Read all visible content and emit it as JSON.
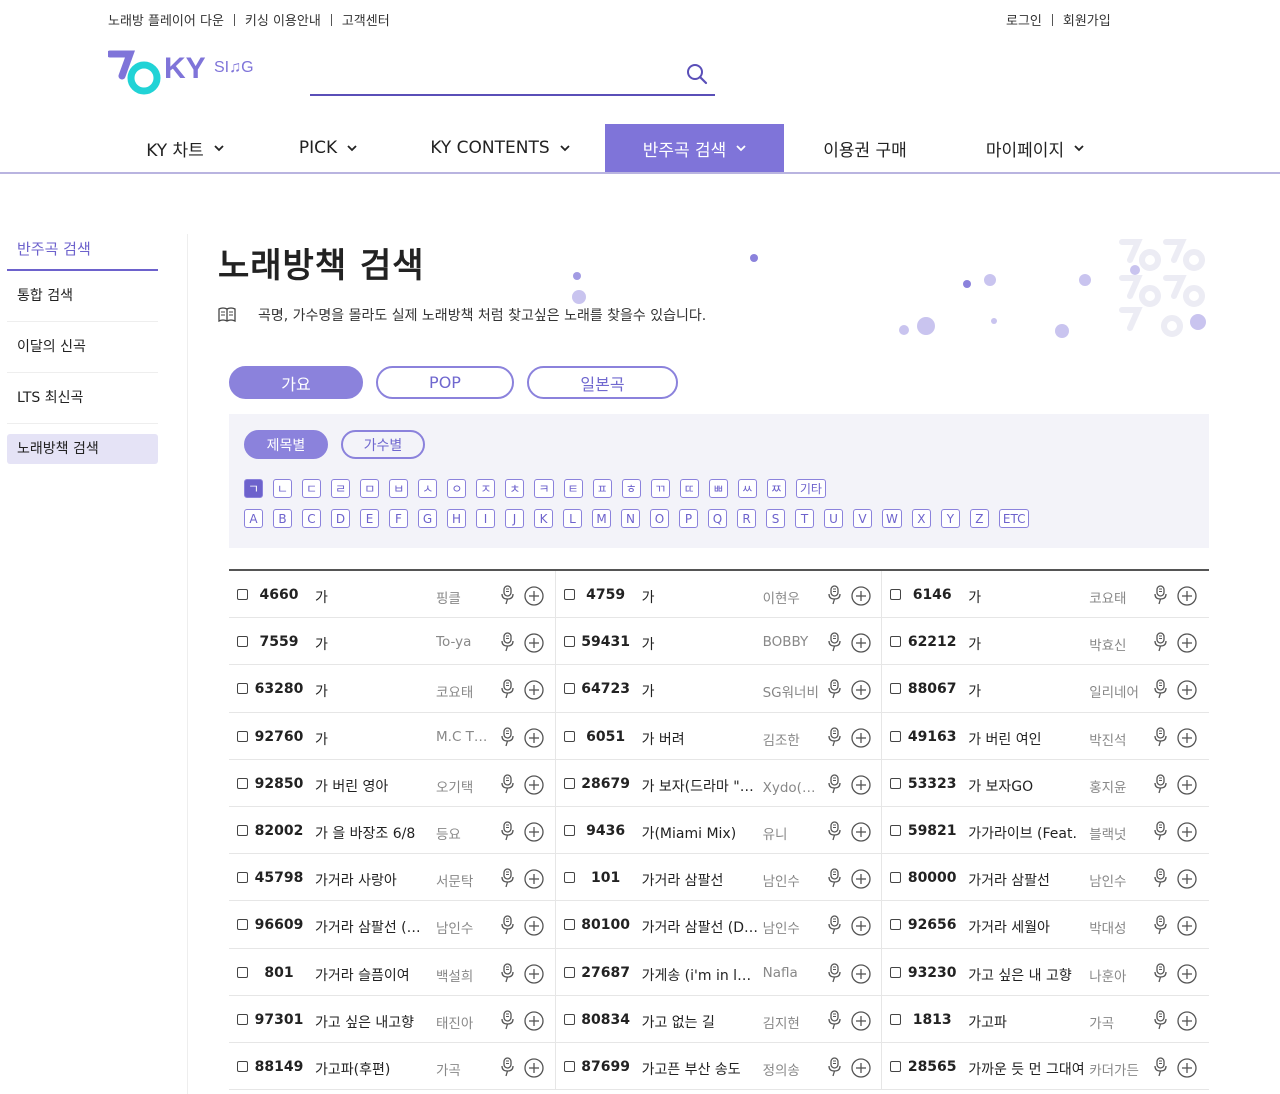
{
  "top_links": [
    "노래방 플레이어 다운",
    "키싱 이용안내",
    "고객센터"
  ],
  "auth_links": [
    "로그인",
    "회원가입"
  ],
  "search": {
    "placeholder": ""
  },
  "nav": [
    {
      "label": "KY 차트",
      "dropdown": true,
      "active": false
    },
    {
      "label": "PICK",
      "dropdown": true,
      "active": false
    },
    {
      "label": "KY CONTENTS",
      "dropdown": true,
      "active": false
    },
    {
      "label": "반주곡 검색",
      "dropdown": true,
      "active": true
    },
    {
      "label": "이용권 구매",
      "dropdown": false,
      "active": false
    },
    {
      "label": "마이페이지",
      "dropdown": true,
      "active": false
    }
  ],
  "sidebar": {
    "title": "반주곡 검색",
    "items": [
      "통합 검색",
      "이달의 신곡",
      "LTS 최신곡",
      "노래방책 검색"
    ],
    "active_index": 3
  },
  "page": {
    "title": "노래방책 검색",
    "description": "곡명, 가수명을 몰라도 실제 노래방책 처럼 찾고싶은 노래를 찾을수 있습니다."
  },
  "categories": [
    "가요",
    "POP",
    "일본곡"
  ],
  "category_active": 0,
  "sort_tabs": [
    "제목별",
    "가수별"
  ],
  "sort_active": 0,
  "korean_keys": [
    "ㄱ",
    "ㄴ",
    "ㄷ",
    "ㄹ",
    "ㅁ",
    "ㅂ",
    "ㅅ",
    "ㅇ",
    "ㅈ",
    "ㅊ",
    "ㅋ",
    "ㅌ",
    "ㅍ",
    "ㅎ",
    "ㄲ",
    "ㄸ",
    "ㅃ",
    "ㅆ",
    "ㅉ",
    "기타"
  ],
  "latin_keys": [
    "A",
    "B",
    "C",
    "D",
    "E",
    "F",
    "G",
    "H",
    "I",
    "J",
    "K",
    "L",
    "M",
    "N",
    "O",
    "P",
    "Q",
    "R",
    "S",
    "T",
    "U",
    "V",
    "W",
    "X",
    "Y",
    "Z",
    "ETC"
  ],
  "active_key": "ㄱ",
  "songs": [
    [
      {
        "num": "4660",
        "title": "가",
        "artist": "핑클"
      },
      {
        "num": "4759",
        "title": "가",
        "artist": "이현우"
      },
      {
        "num": "6146",
        "title": "가",
        "artist": "코요태"
      }
    ],
    [
      {
        "num": "7559",
        "title": "가",
        "artist": "To-ya"
      },
      {
        "num": "59431",
        "title": "가",
        "artist": "BOBBY"
      },
      {
        "num": "62212",
        "title": "가",
        "artist": "박효신"
      }
    ],
    [
      {
        "num": "63280",
        "title": "가",
        "artist": "코요태"
      },
      {
        "num": "64723",
        "title": "가",
        "artist": "SG워너비"
      },
      {
        "num": "88067",
        "title": "가",
        "artist": "일리네어"
      }
    ],
    [
      {
        "num": "92760",
        "title": "가",
        "artist": "M.C THE MAX"
      },
      {
        "num": "6051",
        "title": "가 버려",
        "artist": "김조한"
      },
      {
        "num": "49163",
        "title": "가 버린 여인",
        "artist": "박진석"
      }
    ],
    [
      {
        "num": "92850",
        "title": "가 버린 영아",
        "artist": "오기택"
      },
      {
        "num": "28679",
        "title": "가 보자(드라마 \"오늘부터 우리는\")",
        "artist": "Xydo(시도)"
      },
      {
        "num": "53323",
        "title": "가 보자GO",
        "artist": "홍지윤"
      }
    ],
    [
      {
        "num": "82002",
        "title": "가 을 바장조 6/8",
        "artist": "등요"
      },
      {
        "num": "9436",
        "title": "가(Miami Mix)",
        "artist": "유니"
      },
      {
        "num": "59821",
        "title": "가가라이브 (Feat.",
        "artist": "블랙넛"
      }
    ],
    [
      {
        "num": "45798",
        "title": "가거라 사랑아",
        "artist": "서문탁"
      },
      {
        "num": "101",
        "title": "가거라 삼팔선",
        "artist": "남인수"
      },
      {
        "num": "80000",
        "title": "가거라 삼팔선",
        "artist": "남인수"
      }
    ],
    [
      {
        "num": "96609",
        "title": "가거라 삼팔선 (디스코)",
        "artist": "남인수"
      },
      {
        "num": "80100",
        "title": "가거라 삼팔선 (Disco)",
        "artist": "남인수"
      },
      {
        "num": "92656",
        "title": "가거라 세월아",
        "artist": "박대성"
      }
    ],
    [
      {
        "num": "801",
        "title": "가거라 슬픔이여",
        "artist": "백설희"
      },
      {
        "num": "27687",
        "title": "가게송 (i'm in love)",
        "artist": "Nafla"
      },
      {
        "num": "93230",
        "title": "가고 싶은 내 고향",
        "artist": "나훈아"
      }
    ],
    [
      {
        "num": "97301",
        "title": "가고 싶은 내고향",
        "artist": "태진아"
      },
      {
        "num": "80834",
        "title": "가고 없는 길",
        "artist": "김지현"
      },
      {
        "num": "1813",
        "title": "가고파",
        "artist": "가곡"
      }
    ],
    [
      {
        "num": "88149",
        "title": "가고파(후편)",
        "artist": "가곡"
      },
      {
        "num": "87699",
        "title": "가고픈 부산 송도",
        "artist": "정의송"
      },
      {
        "num": "28565",
        "title": "가까운 듯 먼 그대여",
        "artist": "카더가든"
      }
    ]
  ],
  "colors": {
    "accent": "#7f74d9",
    "accent_dark": "#5a4fb8",
    "teal": "#21d3d6"
  }
}
